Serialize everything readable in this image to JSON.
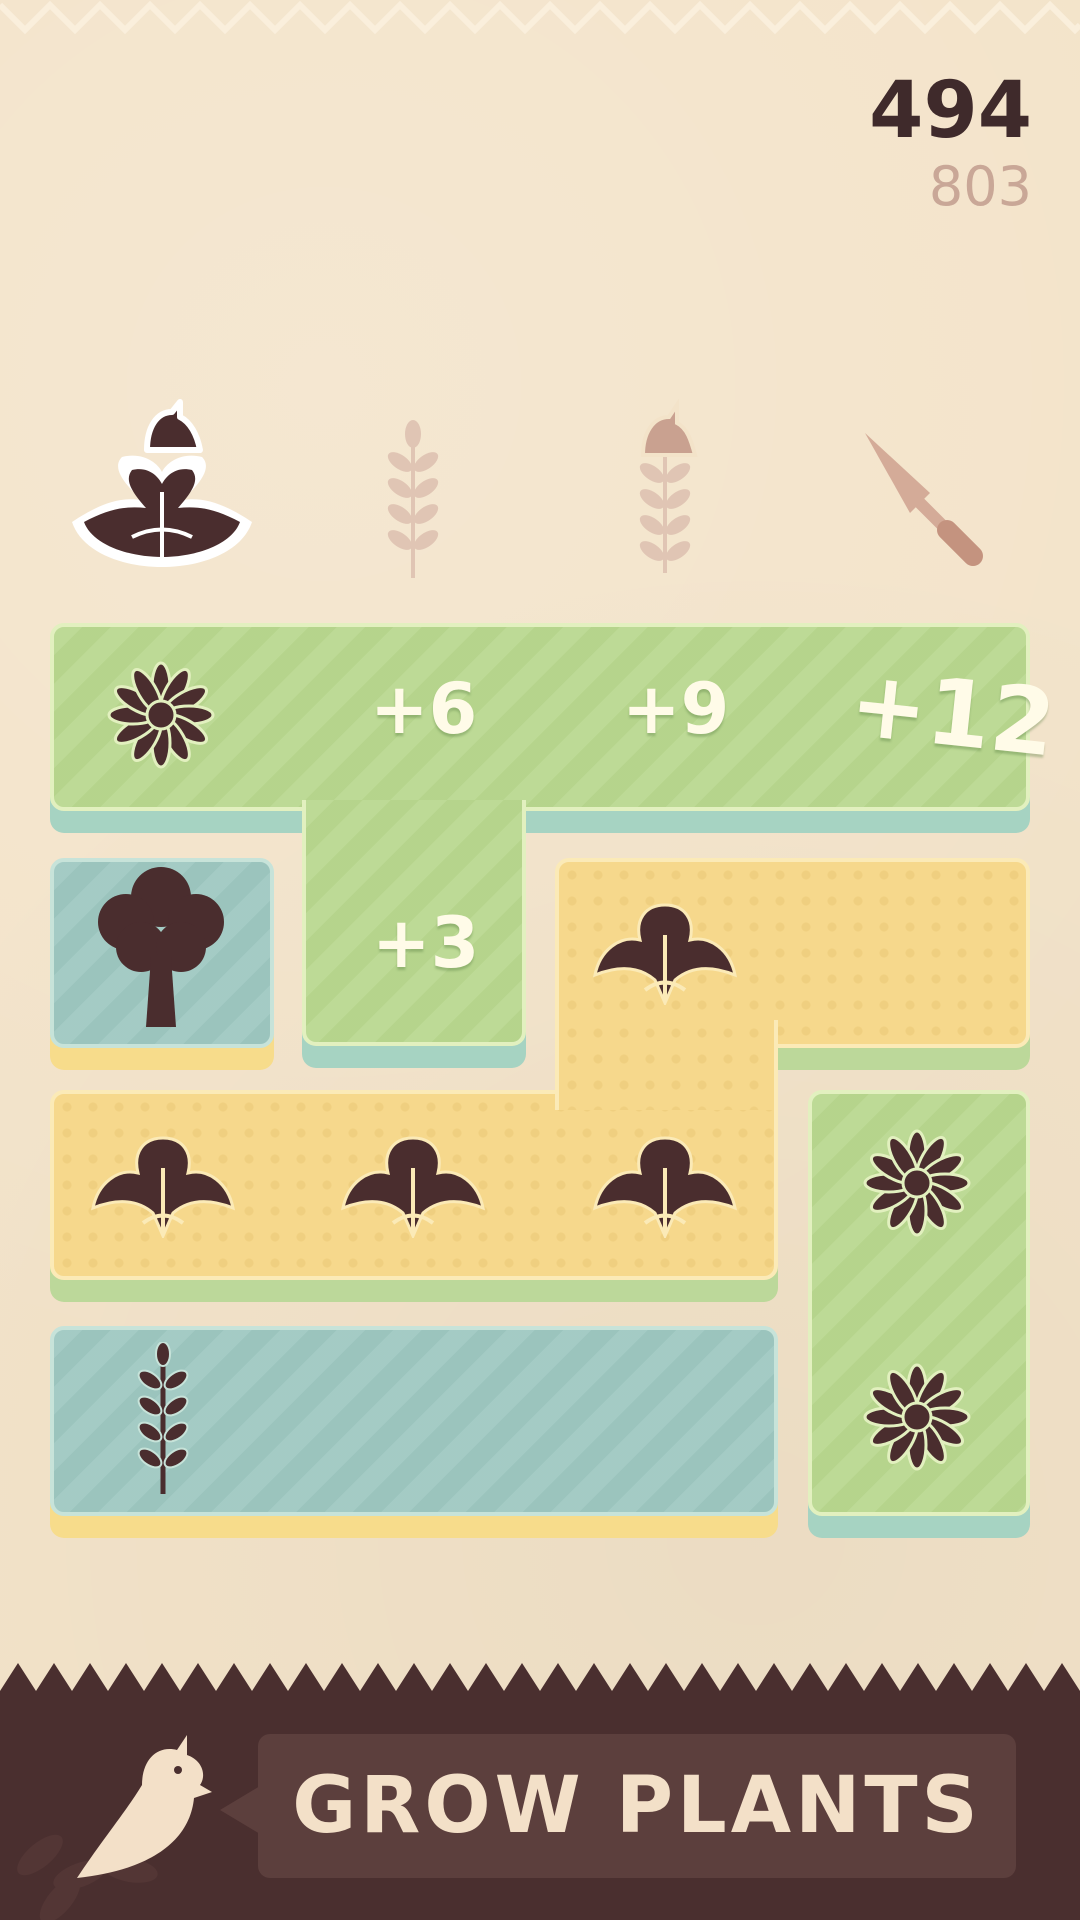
{
  "score": {
    "current": "494",
    "best": "803"
  },
  "queue": {
    "items": [
      "bird-on-bush-icon",
      "wheat-sprout-icon",
      "bird-on-sprout-icon",
      "trowel-icon"
    ]
  },
  "board": {
    "bonuses": [
      "+6",
      "+9",
      "+12",
      "+3"
    ],
    "colors": {
      "green": "#b9d88f",
      "teal": "#9ec8c1",
      "yellow": "#f6d88c",
      "icon": "#4a2d2e"
    }
  },
  "action": {
    "label": "GROW PLANTS"
  },
  "colors": {
    "background": "#f3e3c9",
    "bar": "#4a2f2f",
    "banner": "#5c3f3d",
    "banner_text": "#f3e0c8"
  }
}
